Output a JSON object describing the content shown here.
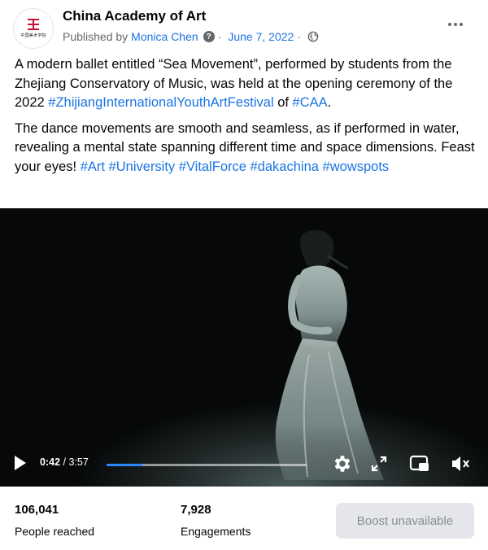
{
  "page": {
    "name": "China Academy of Art",
    "avatar_text": "中国美术学院"
  },
  "meta": {
    "published_by": "Published by",
    "author": "Monica Chen",
    "help": "?",
    "separator": "·",
    "date": "June 7, 2022",
    "separator2": "·",
    "audience_icon": "globe-icon"
  },
  "more_icon": "more-options-icon",
  "post": {
    "p1_text_a": "A modern ballet entitled “Sea Movement”, performed by students from the Zhejiang Conservatory of Music, was held at the opening ceremony of the 2022 ",
    "p1_tag_a": "#ZhijiangInternationalYouthArtFestival",
    "p1_text_b": " of ",
    "p1_tag_b": "#CAA",
    "p1_text_c": ".",
    "p2_text_a": "The dance movements are smooth and seamless, as if performed in water, revealing a mental state spanning different time and space dimensions. Feast your eyes! ",
    "p2_tags": [
      "#Art",
      "#University",
      "#VitalForce",
      "#dakachina",
      "#wowspots"
    ]
  },
  "video": {
    "current_time": "0:42",
    "separator": " / ",
    "duration": "3:57",
    "progress_fraction": 0.177,
    "icons": [
      "play-icon",
      "settings-icon",
      "fullscreen-icon",
      "picture-in-picture-icon",
      "mute-icon"
    ],
    "progress_color": "#2d88ff"
  },
  "footer": {
    "reach_value": "106,041",
    "reach_label": "People reached",
    "engagement_value": "7,928",
    "engagement_label": "Engagements",
    "boost_label": "Boost unavailable"
  },
  "colors": {
    "link": "#1b74e4",
    "secondary_text": "#65676b",
    "boost_bg": "#e4e6eb",
    "boost_text": "#8a8d91"
  }
}
